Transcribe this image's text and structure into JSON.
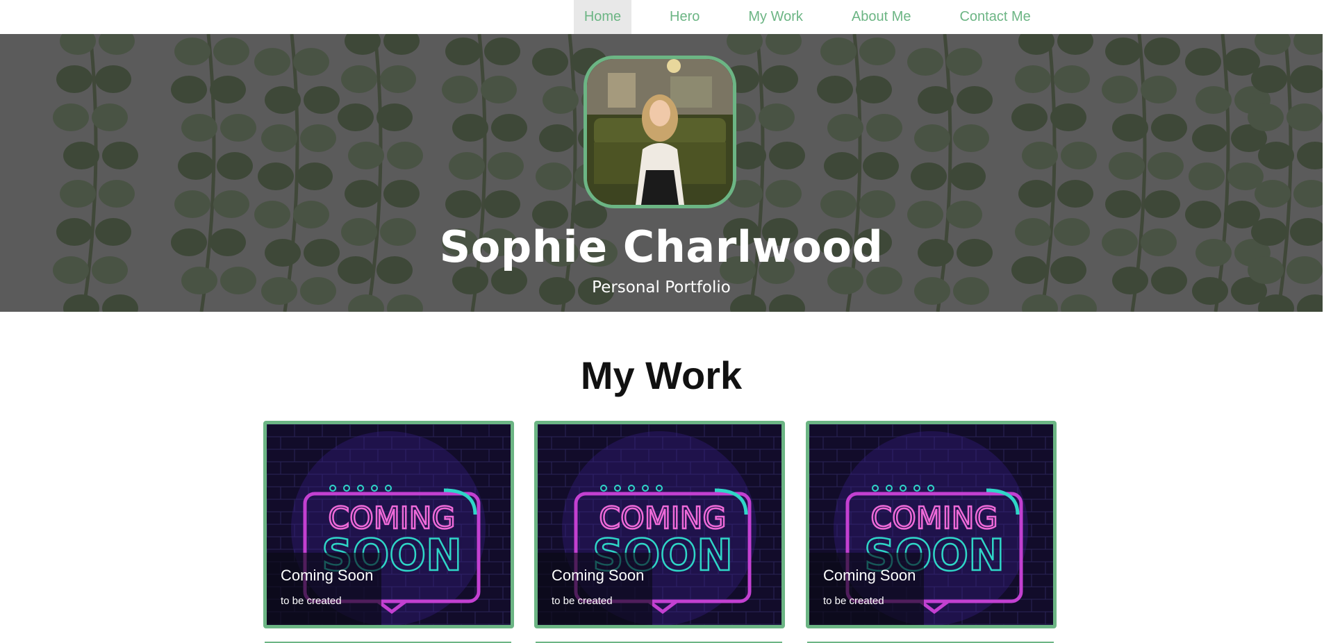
{
  "nav": {
    "items": [
      {
        "label": "Home",
        "active": true
      },
      {
        "label": "Hero",
        "active": false
      },
      {
        "label": "My Work",
        "active": false
      },
      {
        "label": "About Me",
        "active": false
      },
      {
        "label": "Contact Me",
        "active": false
      }
    ]
  },
  "hero": {
    "name": "Sophie Charlwood",
    "subtitle": "Personal Portfolio"
  },
  "work": {
    "title": "My Work",
    "cards": [
      {
        "title": "Coming Soon",
        "description": "to be created",
        "image_text_top": "COMING",
        "image_text_bottom": "SOON"
      },
      {
        "title": "Coming Soon",
        "description": "to be created",
        "image_text_top": "COMING",
        "image_text_bottom": "SOON"
      },
      {
        "title": "Coming Soon",
        "description": "to be created",
        "image_text_top": "COMING",
        "image_text_bottom": "SOON"
      }
    ]
  },
  "colors": {
    "accent": "#6cb584",
    "hero_overlay": "#5b5b5b",
    "neon_pink": "#e04fd8",
    "neon_teal": "#2fd6c7"
  }
}
